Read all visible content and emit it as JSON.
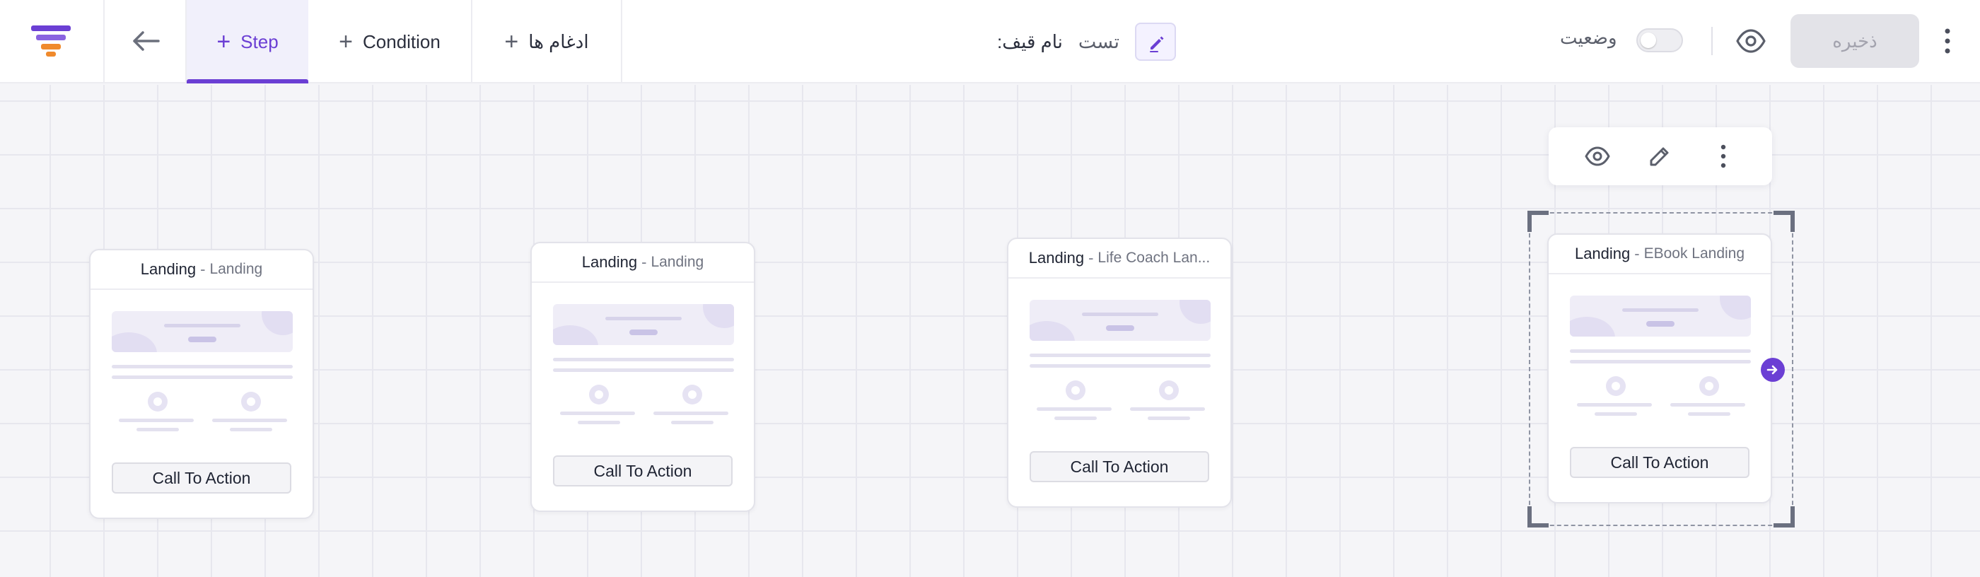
{
  "toolbar": {
    "tabs": [
      {
        "label": "Step",
        "plus": "+",
        "active": true
      },
      {
        "label": "Condition",
        "plus": "+"
      },
      {
        "label": "ادغام ها",
        "plus": "+"
      }
    ],
    "funnel_name_label": ":نام قیف",
    "funnel_name_value": "تست",
    "status_label": "وضعیت",
    "status_enabled": false,
    "save_label": "ذخیره"
  },
  "colors": {
    "accent": "#6b3fd4",
    "logo_top": "#6b3fd4",
    "logo_bottom": "#f08a2c",
    "canvas_bg": "#f5f5f8"
  },
  "nodes": [
    {
      "type": "Landing",
      "separator": "-",
      "name": "Landing",
      "cta": "Call To Action",
      "selected": false
    },
    {
      "type": "Landing",
      "separator": "-",
      "name": "Landing",
      "cta": "Call To Action",
      "selected": false
    },
    {
      "type": "Landing",
      "separator": "-",
      "name": "Life Coach Lan...",
      "cta": "Call To Action",
      "selected": false
    },
    {
      "type": "Landing",
      "separator": "-",
      "name": "EBook Landing",
      "cta": "Call To Action",
      "selected": true
    }
  ],
  "icons": {
    "logo": "funnel-logo-icon",
    "back": "arrow-left-icon",
    "edit": "pencil-icon",
    "preview": "eye-icon",
    "more": "more-vertical-icon",
    "connector": "arrow-right-circle-icon"
  }
}
